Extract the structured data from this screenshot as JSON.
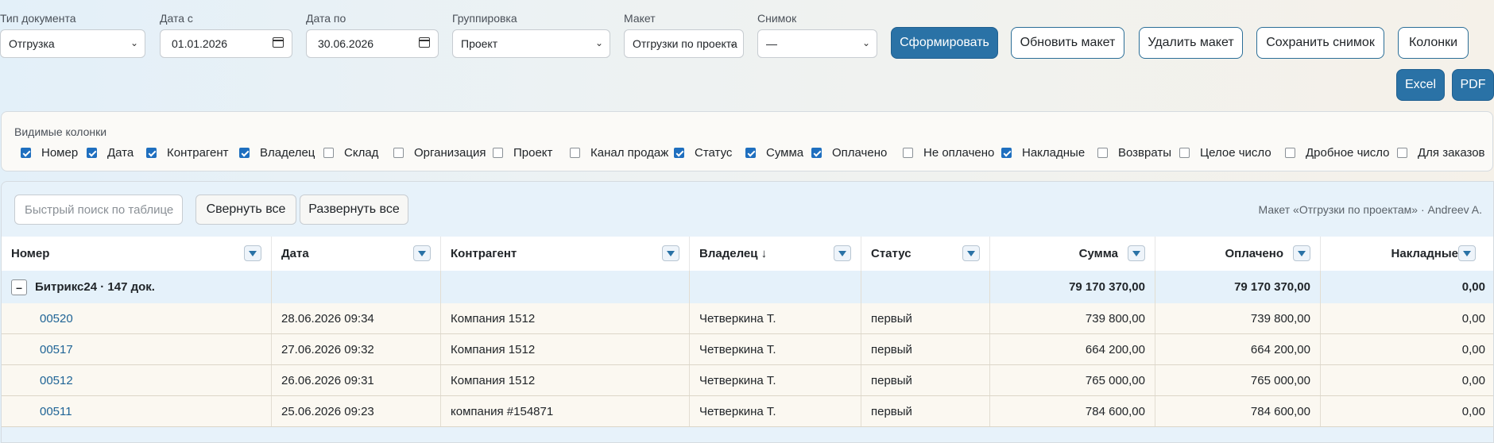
{
  "filters": {
    "doc_type": {
      "label": "Тип документа",
      "value": "Отгрузка"
    },
    "date_from": {
      "label": "Дата с",
      "value": "01.01.2026"
    },
    "date_to": {
      "label": "Дата по",
      "value": "30.06.2026"
    },
    "grouping": {
      "label": "Группировка",
      "value": "Проект"
    },
    "layout": {
      "label": "Макет",
      "value": "Отгрузки по проекта"
    },
    "snapshot": {
      "label": "Снимок",
      "value": "—"
    }
  },
  "toolbar": {
    "generate": "Сформировать",
    "update_layout": "Обновить макет",
    "delete_layout": "Удалить макет",
    "save_snapshot": "Сохранить снимок",
    "columns": "Колонки",
    "excel": "Excel",
    "pdf": "PDF"
  },
  "columns_panel": {
    "title": "Видимые колонки",
    "items": [
      {
        "label": "Номер",
        "checked": true
      },
      {
        "label": "Дата",
        "checked": true
      },
      {
        "label": "Контрагент",
        "checked": true
      },
      {
        "label": "Владелец",
        "checked": true
      },
      {
        "label": "Склад",
        "checked": false
      },
      {
        "label": "Организация",
        "checked": false
      },
      {
        "label": "Проект",
        "checked": false
      },
      {
        "label": "Канал продаж",
        "checked": false
      },
      {
        "label": "Статус",
        "checked": true
      },
      {
        "label": "Сумма",
        "checked": true
      },
      {
        "label": "Оплачено",
        "checked": true
      },
      {
        "label": "Не оплачено",
        "checked": false
      },
      {
        "label": "Накладные",
        "checked": true
      },
      {
        "label": "Возвраты",
        "checked": false
      },
      {
        "label": "Целое число",
        "checked": false
      },
      {
        "label": "Дробное число",
        "checked": false
      },
      {
        "label": "Для заказов",
        "checked": false
      }
    ]
  },
  "table_toolbar": {
    "search_placeholder": "Быстрый поиск по таблице",
    "collapse_all": "Свернуть все",
    "expand_all": "Развернуть все",
    "meta": "Макет «Отгрузки по проектам» · Andreev A."
  },
  "table": {
    "headers": [
      "Номер",
      "Дата",
      "Контрагент",
      "Владелец ↓",
      "Статус",
      "Сумма",
      "Оплачено",
      "Накладные"
    ],
    "group": {
      "toggle": "–",
      "label": "Битрикс24 · 147 док.",
      "sum": "79 170 370,00",
      "paid": "79 170 370,00",
      "invoices": "0,00"
    },
    "rows": [
      {
        "number": "00520",
        "date": "28.06.2026 09:34",
        "counterparty": "Компания 1512",
        "owner": "Четверкина Т.",
        "status": "первый",
        "sum": "739 800,00",
        "paid": "739 800,00",
        "invoices": "0,00"
      },
      {
        "number": "00517",
        "date": "27.06.2026 09:32",
        "counterparty": "Компания 1512",
        "owner": "Четверкина Т.",
        "status": "первый",
        "sum": "664 200,00",
        "paid": "664 200,00",
        "invoices": "0,00"
      },
      {
        "number": "00512",
        "date": "26.06.2026 09:31",
        "counterparty": "Компания 1512",
        "owner": "Четверкина Т.",
        "status": "первый",
        "sum": "765 000,00",
        "paid": "765 000,00",
        "invoices": "0,00"
      },
      {
        "number": "00511",
        "date": "25.06.2026 09:23",
        "counterparty": "компания #154871",
        "owner": "Четверкина Т.",
        "status": "первый",
        "sum": "784 600,00",
        "paid": "784 600,00",
        "invoices": "0,00"
      }
    ]
  }
}
